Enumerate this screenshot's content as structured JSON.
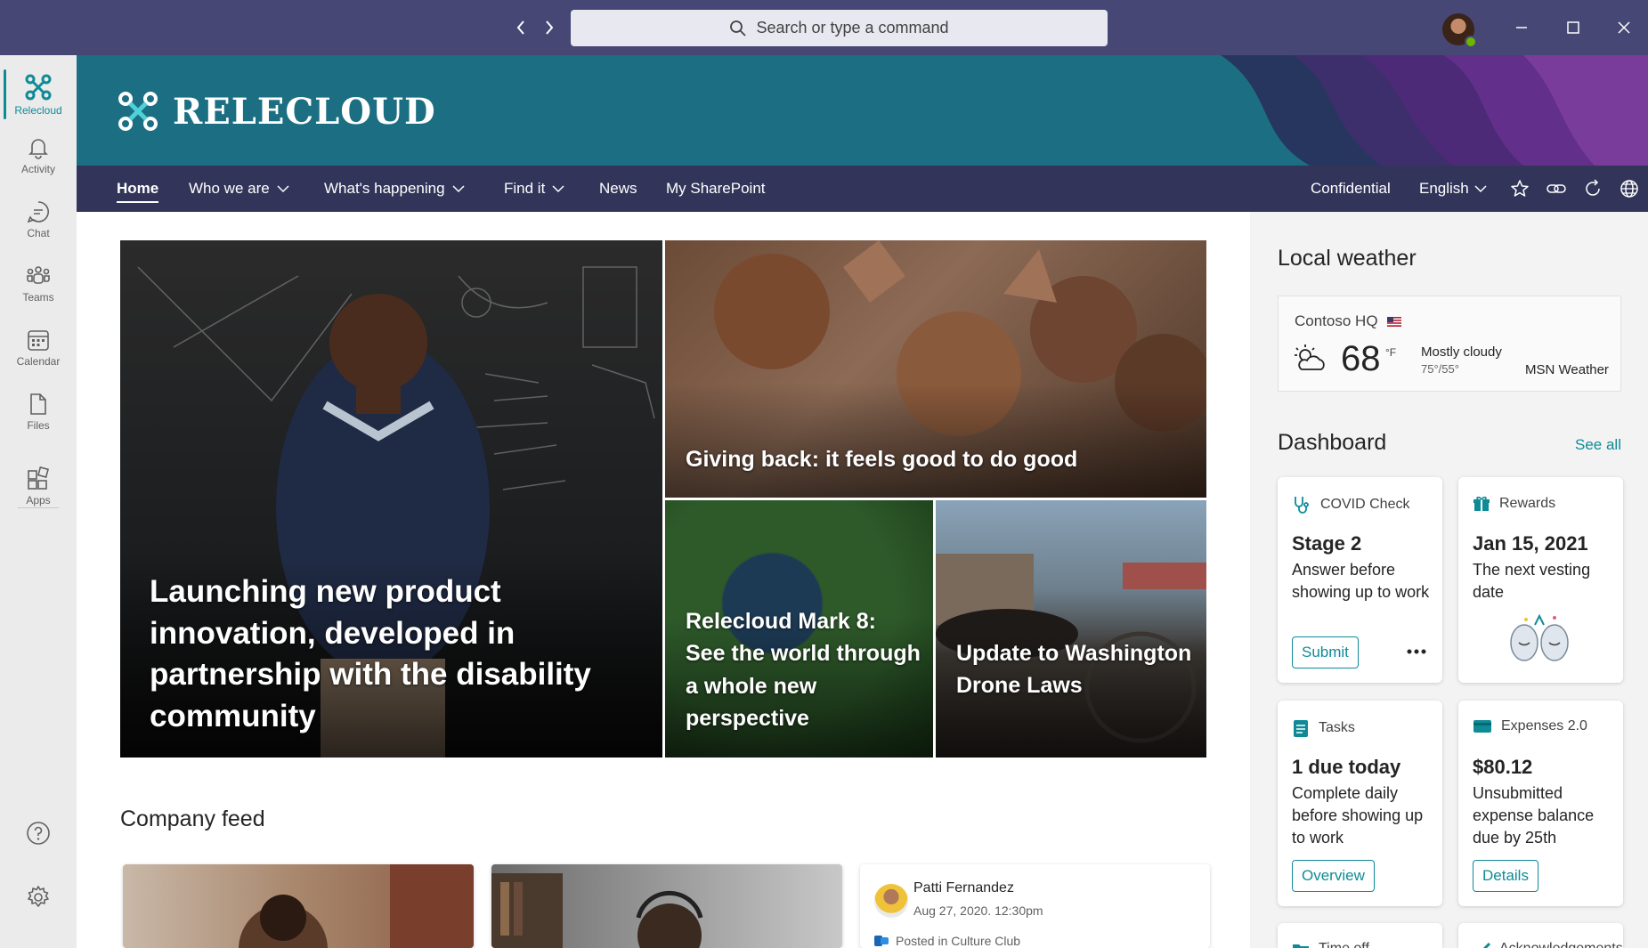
{
  "titlebar": {
    "search_placeholder": "Search or type a command"
  },
  "rail": {
    "items": [
      {
        "label": "Relecloud",
        "icon": "relecloud-icon"
      },
      {
        "label": "Activity",
        "icon": "bell-icon"
      },
      {
        "label": "Chat",
        "icon": "chat-icon"
      },
      {
        "label": "Teams",
        "icon": "teams-icon"
      },
      {
        "label": "Calendar",
        "icon": "calendar-icon"
      },
      {
        "label": "Files",
        "icon": "file-icon"
      },
      {
        "label": "Apps",
        "icon": "apps-icon"
      }
    ]
  },
  "site": {
    "logo_text": "RELECLOUD",
    "nav": {
      "home": "Home",
      "who_we_are": "Who we are",
      "whats_happening": "What's happening",
      "find_it": "Find it",
      "news": "News",
      "my_sharepoint": "My SharePoint",
      "confidential": "Confidential",
      "language": "English"
    }
  },
  "hero": {
    "main_caption": "Launching new product innovation, developed in partnership with the disability community",
    "top_right_caption": "Giving back: it feels good to do good",
    "bottom_left_caption": "Relecloud Mark 8: See the world through a whole new perspective",
    "bottom_right_caption": "Update to Washington Drone Laws"
  },
  "feed": {
    "title": "Company feed",
    "post": {
      "author": "Patti Fernandez",
      "timestamp": "Aug 27, 2020. 12:30pm",
      "posted_in": "Posted in Culture Club"
    }
  },
  "weather": {
    "title": "Local weather",
    "location": "Contoso HQ",
    "temperature": "68",
    "unit": "°F",
    "condition": "Mostly cloudy",
    "range": "75°/55°",
    "source": "MSN Weather"
  },
  "dashboard": {
    "title": "Dashboard",
    "see_all": "See all",
    "cards": {
      "covid": {
        "head": "COVID Check",
        "title": "Stage 2",
        "body": "Answer before showing up to work",
        "button": "Submit"
      },
      "rewards": {
        "head": "Rewards",
        "title": "Jan 15, 2021",
        "body": "The next vesting date"
      },
      "tasks": {
        "head": "Tasks",
        "title": "1 due today",
        "body": "Complete daily before showing up to work",
        "button": "Overview"
      },
      "expenses": {
        "head": "Expenses 2.0",
        "title": "$80.12",
        "body": "Unsubmitted expense balance due by 25th",
        "button": "Details"
      },
      "partial_1": {
        "head": "Time off"
      },
      "partial_2": {
        "head": "Acknowledgements"
      }
    }
  },
  "colors": {
    "titlebar": "#464775",
    "banner": "#1c6f82",
    "sitenav": "#323559",
    "accent": "#0f8b98"
  }
}
